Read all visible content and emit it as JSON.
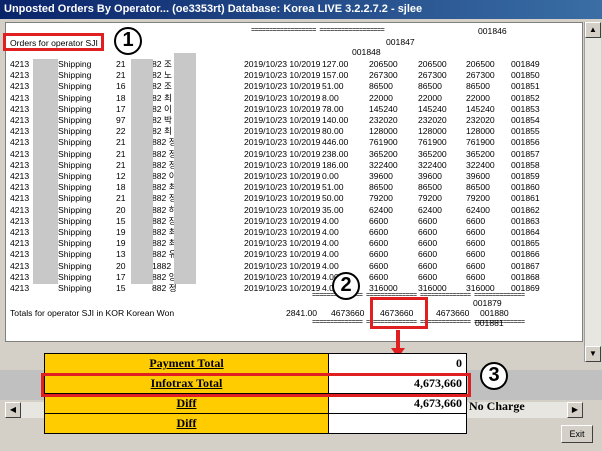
{
  "window": {
    "title": "Unposted Orders By Operator... (oe3353rt)  Database: Korea LIVE 3.2.2.7.2 - sjlee"
  },
  "report": {
    "header_sep": "================== ==================",
    "top_id_1": "001846",
    "top_id_2": "001847",
    "top_id_3": "001848",
    "operator_label": "Orders for operator SJI",
    "rows": [
      {
        "c1": "4213",
        "c2": "Shipping",
        "c3": "21",
        "c4": "82 조",
        "c5": "2019/10/23 10/2019",
        "c6": "127.00",
        "c7": "206500",
        "c8": "206500",
        "c9": "206500",
        "c10": "001849"
      },
      {
        "c1": "4213",
        "c2": "Shipping",
        "c3": "21",
        "c4": "82 노",
        "c5": "2019/10/23 10/2019",
        "c6": "157.00",
        "c7": "267300",
        "c8": "267300",
        "c9": "267300",
        "c10": "001850"
      },
      {
        "c1": "4213",
        "c2": "Shipping",
        "c3": "16",
        "c4": "82 조",
        "c5": "2019/10/23 10/2019",
        "c6": "51.00",
        "c7": "86500",
        "c8": "86500",
        "c9": "86500",
        "c10": "001851"
      },
      {
        "c1": "4213",
        "c2": "Shipping",
        "c3": "18",
        "c4": "82 최",
        "c5": "2019/10/23 10/2019",
        "c6": "8.00",
        "c7": "22000",
        "c8": "22000",
        "c9": "22000",
        "c10": "001852"
      },
      {
        "c1": "4213",
        "c2": "Shipping",
        "c3": "17",
        "c4": "82 이",
        "c5": "2019/10/23 10/2019",
        "c6": "78.00",
        "c7": "145240",
        "c8": "145240",
        "c9": "145240",
        "c10": "001853"
      },
      {
        "c1": "4213",
        "c2": "Shipping",
        "c3": "97",
        "c4": "82 박",
        "c5": "2019/10/23 10/2019",
        "c6": "140.00",
        "c7": "232020",
        "c8": "232020",
        "c9": "232020",
        "c10": "001854"
      },
      {
        "c1": "4213",
        "c2": "Shipping",
        "c3": "22",
        "c4": "82 최",
        "c5": "2019/10/23 10/2019",
        "c6": "80.00",
        "c7": "128000",
        "c8": "128000",
        "c9": "128000",
        "c10": "001855"
      },
      {
        "c1": "4213",
        "c2": "Shipping",
        "c3": "21",
        "c4": "882 정",
        "c5": "2019/10/23 10/2019",
        "c6": "446.00",
        "c7": "761900",
        "c8": "761900",
        "c9": "761900",
        "c10": "001856"
      },
      {
        "c1": "4213",
        "c2": "Shipping",
        "c3": "21",
        "c4": "882 정",
        "c5": "2019/10/23 10/2019",
        "c6": "238.00",
        "c7": "365200",
        "c8": "365200",
        "c9": "365200",
        "c10": "001857"
      },
      {
        "c1": "4213",
        "c2": "Shipping",
        "c3": "21",
        "c4": "882 정",
        "c5": "2019/10/23 10/2019",
        "c6": "186.00",
        "c7": "322400",
        "c8": "322400",
        "c9": "322400",
        "c10": "001858"
      },
      {
        "c1": "4213",
        "c2": "Shipping",
        "c3": "12",
        "c4": "882 이",
        "c5": "2019/10/23 10/2019",
        "c6": "0.00",
        "c7": "39600",
        "c8": "39600",
        "c9": "39600",
        "c10": "001859"
      },
      {
        "c1": "4213",
        "c2": "Shipping",
        "c3": "18",
        "c4": "882 최",
        "c5": "2019/10/23 10/2019",
        "c6": "51.00",
        "c7": "86500",
        "c8": "86500",
        "c9": "86500",
        "c10": "001860"
      },
      {
        "c1": "4213",
        "c2": "Shipping",
        "c3": "21",
        "c4": "882 정",
        "c5": "2019/10/23 10/2019",
        "c6": "50.00",
        "c7": "79200",
        "c8": "79200",
        "c9": "79200",
        "c10": "001861"
      },
      {
        "c1": "4213",
        "c2": "Shipping",
        "c3": "20",
        "c4": "882 하",
        "c5": "2019/10/23 10/2019",
        "c6": "35.00",
        "c7": "62400",
        "c8": "62400",
        "c9": "62400",
        "c10": "001862"
      },
      {
        "c1": "4213",
        "c2": "Shipping",
        "c3": "15",
        "c4": "882 장",
        "c5": "2019/10/23 10/2019",
        "c6": "4.00",
        "c7": "6600",
        "c8": "6600",
        "c9": "6600",
        "c10": "001863"
      },
      {
        "c1": "4213",
        "c2": "Shipping",
        "c3": "19",
        "c4": "882 최",
        "c5": "2019/10/23 10/2019",
        "c6": "4.00",
        "c7": "6600",
        "c8": "6600",
        "c9": "6600",
        "c10": "001864"
      },
      {
        "c1": "4213",
        "c2": "Shipping",
        "c3": "19",
        "c4": "882 최",
        "c5": "2019/10/23 10/2019",
        "c6": "4.00",
        "c7": "6600",
        "c8": "6600",
        "c9": "6600",
        "c10": "001865"
      },
      {
        "c1": "4213",
        "c2": "Shipping",
        "c3": "13",
        "c4": "882 유",
        "c5": "2019/10/23 10/2019",
        "c6": "4.00",
        "c7": "6600",
        "c8": "6600",
        "c9": "6600",
        "c10": "001866"
      },
      {
        "c1": "4213",
        "c2": "Shipping",
        "c3": "20",
        "c4": "1882 김",
        "c5": "2019/10/23 10/2019",
        "c6": "4.00",
        "c7": "6600",
        "c8": "6600",
        "c9": "6600",
        "c10": "001867"
      },
      {
        "c1": "4213",
        "c2": "Shipping",
        "c3": "17",
        "c4": "882 양",
        "c5": "2019/10/23 10/2019",
        "c6": "4.00",
        "c7": "6600",
        "c8": "6600",
        "c9": "6600",
        "c10": "001868"
      },
      {
        "c1": "4213",
        "c2": "Shipping",
        "c3": "15",
        "c4": "882 정",
        "c5": "2019/10/23 10/2019",
        "c6": "4.00",
        "c7": "316000",
        "c8": "316000",
        "c9": "316000",
        "c10": "001869"
      }
    ],
    "totals_label": "Totals for operator SJI in KOR  Korean Won",
    "totals_qty": "2841.00",
    "totals_v1": "4673660",
    "totals_v2": "4673660",
    "totals_v3": "4673660",
    "totals_v4": "4673660",
    "sep_id_1": "001879",
    "sep_id_2": "001880",
    "sep_id_3": "001881",
    "sep_line": "============== ============== ============== =============="
  },
  "summary": {
    "payment_total_label": "Payment Total",
    "payment_total_value": "0",
    "infotrax_total_label": "Infotrax Total",
    "infotrax_total_value": "4,673,660",
    "diff_label": "Diff",
    "diff_value": "4,673,660",
    "diff_note": "No Charge",
    "diff2_label": "Diff",
    "diff2_value": ""
  },
  "badges": {
    "one": "1",
    "two": "2",
    "three": "3"
  },
  "buttons": {
    "exit": "Exit"
  },
  "colors": {
    "accent_red": "#e02020",
    "highlight_yellow": "#ffcc00"
  }
}
